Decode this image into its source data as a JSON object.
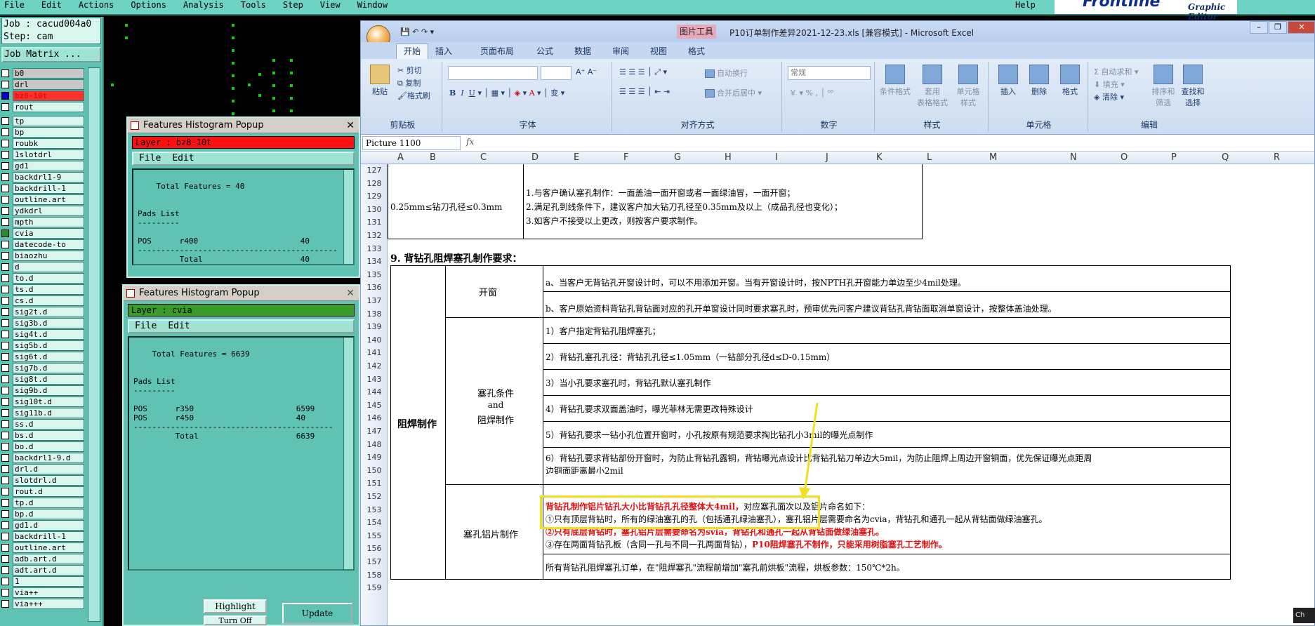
{
  "frontline": {
    "menu": [
      "File",
      "Edit",
      "Actions",
      "Options",
      "Analysis",
      "Tools",
      "Step",
      "View",
      "Window"
    ],
    "help": "Help",
    "logo_name": "Frontline",
    "logo_sub": "Graphic Editor"
  },
  "job": {
    "job_line": "Job : cacud004a0",
    "step_line": "Step: cam",
    "matrix_label": "Job Matrix ..."
  },
  "layers": [
    {
      "name": "b0",
      "state": "gray"
    },
    {
      "name": "drl",
      "state": "gray"
    },
    {
      "name": "bz8-10t",
      "state": "red",
      "selected": true
    },
    {
      "name": "rout",
      "state": "normal"
    },
    {
      "name": "tp",
      "state": "normal",
      "sep": true
    },
    {
      "name": "bp",
      "state": "normal"
    },
    {
      "name": "roubk",
      "state": "normal"
    },
    {
      "name": "1slotdrl",
      "state": "normal"
    },
    {
      "name": "gd1",
      "state": "normal"
    },
    {
      "name": "backdrl1-9",
      "state": "normal"
    },
    {
      "name": "backdrill-1",
      "state": "normal"
    },
    {
      "name": "outline.art",
      "state": "normal"
    },
    {
      "name": "ydkdrl",
      "state": "normal"
    },
    {
      "name": "mpth",
      "state": "normal"
    },
    {
      "name": "cvia",
      "state": "normal",
      "green": true
    },
    {
      "name": "datecode-to",
      "state": "normal"
    },
    {
      "name": "biaozhu",
      "state": "normal"
    },
    {
      "name": "d",
      "state": "normal"
    },
    {
      "name": "to.d",
      "state": "normal"
    },
    {
      "name": "ts.d",
      "state": "normal"
    },
    {
      "name": "cs.d",
      "state": "normal"
    },
    {
      "name": "sig2t.d",
      "state": "normal"
    },
    {
      "name": "sig3b.d",
      "state": "normal"
    },
    {
      "name": "sig4t.d",
      "state": "normal"
    },
    {
      "name": "sig5b.d",
      "state": "normal"
    },
    {
      "name": "sig6t.d",
      "state": "normal"
    },
    {
      "name": "sig7b.d",
      "state": "normal"
    },
    {
      "name": "sig8t.d",
      "state": "normal"
    },
    {
      "name": "sig9b.d",
      "state": "normal"
    },
    {
      "name": "sig10t.d",
      "state": "normal"
    },
    {
      "name": "sig11b.d",
      "state": "normal"
    },
    {
      "name": "ss.d",
      "state": "normal"
    },
    {
      "name": "bs.d",
      "state": "normal"
    },
    {
      "name": "bo.d",
      "state": "normal"
    },
    {
      "name": "backdrl1-9.d",
      "state": "normal"
    },
    {
      "name": "drl.d",
      "state": "normal"
    },
    {
      "name": "slotdrl.d",
      "state": "normal"
    },
    {
      "name": "rout.d",
      "state": "normal"
    },
    {
      "name": "tp.d",
      "state": "normal"
    },
    {
      "name": "bp.d",
      "state": "normal"
    },
    {
      "name": "gd1.d",
      "state": "normal"
    },
    {
      "name": "backdrill-1",
      "state": "normal"
    },
    {
      "name": "outline.art",
      "state": "normal"
    },
    {
      "name": "adb.art.d",
      "state": "normal"
    },
    {
      "name": "adt.art.d",
      "state": "normal"
    },
    {
      "name": "1",
      "state": "normal"
    },
    {
      "name": "via++",
      "state": "normal"
    },
    {
      "name": "via+++",
      "state": "normal"
    }
  ],
  "popup1": {
    "title": "Features Histogram Popup",
    "layer": "Layer :  bz8-10t",
    "menu": [
      "File",
      "Edit"
    ],
    "text": "Total Features = 40\n\n\nPads List\n---------\n\nPOS      r400                      40\n-------------------------------------------\n         Total                     40",
    "close": "✕"
  },
  "popup2": {
    "title": "Features Histogram Popup",
    "layer": "Layer :  cvia",
    "menu": [
      "File",
      "Edit"
    ],
    "text": "Total Features = 6639\n\n\nPads List\n---------\n\nPOS      r350                      6599\nPOS      r450                      40\n-------------------------------------------\n         Total                     6639",
    "close": "✕",
    "btn_highlight": "Highlight",
    "btn_turnoff": "Turn Off",
    "btn_update": "Update"
  },
  "excel": {
    "tools_label": "图片工具",
    "doc_title": "P10订单制作差异2021-12-23.xls  [兼容模式] - Microsoft Excel",
    "tabs": [
      "开始",
      "插入",
      "页面布局",
      "公式",
      "数据",
      "审阅",
      "视图",
      "格式"
    ],
    "ribbon": {
      "paste": "粘贴",
      "cut": "剪切",
      "copy": "复制",
      "format_painter": "格式刷",
      "clipboard": "剪贴板",
      "font": "字体",
      "wrap": "自动换行",
      "merge": "合并后居中",
      "align": "对齐方式",
      "number_format": "常规",
      "number": "数字",
      "cond_format": "条件格式",
      "table_format": "套用\n表格格式",
      "cell_style": "单元格\n样式",
      "styles": "样式",
      "insert": "插入",
      "delete": "删除",
      "format": "格式",
      "cells": "单元格",
      "autosum": "自动求和",
      "fill": "填充",
      "clear": "清除",
      "sort": "排序和\n筛选",
      "find": "查找和\n选择",
      "edit": "编辑"
    },
    "namebox": "Picture 1100",
    "fx": "fx",
    "columns": [
      "A",
      "B",
      "C",
      "D",
      "E",
      "F",
      "G",
      "H",
      "I",
      "J",
      "K",
      "L",
      "M",
      "N",
      "O",
      "P",
      "Q",
      "R"
    ],
    "rows": [
      "127",
      "128",
      "129",
      "130",
      "131",
      "132",
      "133",
      "134",
      "135",
      "136",
      "137",
      "138",
      "139",
      "140",
      "141",
      "142",
      "143",
      "144",
      "145",
      "146",
      "147",
      "148",
      "149",
      "150",
      "151",
      "152",
      "153",
      "154",
      "155",
      "156",
      "157",
      "158",
      "159"
    ],
    "sheet": {
      "drill_range": "0.25mm≤钻刀孔径≤0.3mm",
      "req1": "1.与客户确认塞孔制作：一面盖油一面开窗或者一面绿油冒，一面开窗；",
      "req2": "2.满足孔到线条件下，建议客户加大钻刀孔径至0.35mm及以上（成品孔径也变化）；",
      "req3": "3.如客户不接受以上更改，则按客户要求制作。",
      "section_title": "9. 背钻孔阻焊塞孔制作要求：",
      "col_a": "阻焊制作",
      "open_window": "开窗",
      "ow_a": "a、当客户无背钻孔开窗设计时，可以不用添加开窗。当有开窗设计时，按NPTH孔开窗能力单边至少4mil处理。",
      "ow_b": "b、客户原始资料背钻孔背钻面对应的孔开单窗设计同时要求塞孔时，预审优先问客户建议背钻孔背钻面取消单窗设计，按整体盖油处理。",
      "plug_cond_1": "塞孔条件",
      "plug_cond_2": "and",
      "plug_cond_3": "阻焊制作",
      "pc1": "1）客户指定背钻孔阻焊塞孔；",
      "pc2": "2）背钻孔塞孔孔径：背钻孔孔径≤1.05mm（一钻部分孔径d≤D-0.15mm）",
      "pc3": "3）当小孔要求塞孔时，背钻孔默认塞孔制作",
      "pc4": "4）背钻孔要求双面盖油时，曝光菲林无需更改特殊设计",
      "pc5": "5）背钻孔要求一钻小孔位置开窗时，小孔按原有规范要求掏比钻孔小3mil的曝光点制作",
      "pc6a": "6）背钻孔要求背钻部份开窗时，为防止背钻孔露铜，背钻曝光点设计比背钻孔钻刀单边大5mil，为防止阻焊上周边开窗铜面，优先保证曝光点距周",
      "pc6b": "边铜面距离最小2mil",
      "plug_sheet": "塞孔铝片制作",
      "ps_red": "背钻孔制作铝片钻孔大小比背钻孔孔径整体大4mil，",
      "ps_rest": "对应塞孔面次以及铝片命名如下：",
      "ps1": "①只有顶层背钻时，所有的绿油塞孔的孔（包括通孔绿油塞孔），塞孔铝片层需要命名为cvia，背钻孔和通孔一起从背钻面做绿油塞孔。",
      "ps2": "②只有底层背钻时，塞孔铝片层需要命名为svia，背钻孔和通孔一起从背钻面做绿油塞孔。",
      "ps3a": "③存在两面背钻孔板（含同一孔与不同一孔两面背钻），",
      "ps3b": "P10阻焊塞孔不制作，只能采用树脂塞孔工艺制作。",
      "last": "所有背钻孔阻焊塞孔订单，在\"阻焊塞孔\"流程前增加\"塞孔前烘板\"流程，烘板参数：150℃*2h。"
    }
  },
  "taskbar": "Ch"
}
